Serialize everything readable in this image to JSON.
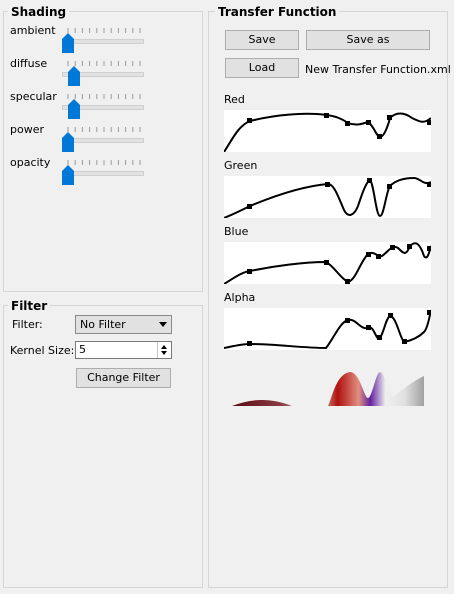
{
  "shading": {
    "title": "Shading",
    "sliders": [
      {
        "label": "ambient",
        "value": 0.0
      },
      {
        "label": "diffuse",
        "value": 0.08
      },
      {
        "label": "specular",
        "value": 0.08
      },
      {
        "label": "power",
        "value": 0.0
      },
      {
        "label": "opacity",
        "value": 0.0
      }
    ]
  },
  "filter": {
    "title": "Filter",
    "filter_label": "Filter:",
    "filter_value": "No Filter",
    "kernel_label": "Kernel Size:",
    "kernel_value": "5",
    "change_button": "Change Filter"
  },
  "transfer": {
    "title": "Transfer Function",
    "save_button": "Save",
    "save_as_button": "Save as",
    "load_button": "Load",
    "filename": "New Transfer Function.xml",
    "channels": [
      {
        "label": "Red"
      },
      {
        "label": "Green"
      },
      {
        "label": "Blue"
      },
      {
        "label": "Alpha"
      }
    ]
  },
  "colors": {
    "accent": "#0078d7",
    "background": "#f0f0f0",
    "curve": "#000000"
  }
}
